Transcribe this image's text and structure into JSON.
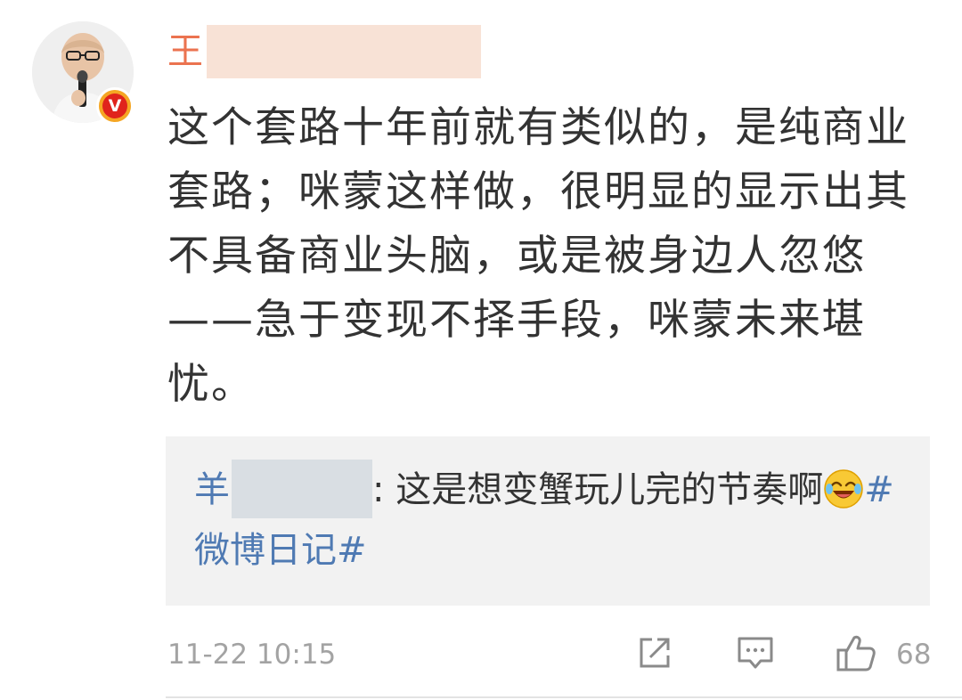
{
  "comment": {
    "author": {
      "name": "王",
      "verified_badge": "V"
    },
    "body": "这个套路十年前就有类似的，是纯商业套路；咪蒙这样做，很明显的显示出其不具备商业头脑，或是被身边人忽悠——急于变现不择手段，咪蒙未来堪忧。",
    "reply": {
      "user": "羊",
      "text_before_emoji": ": 这是想变蟹玩儿完的节奏啊",
      "emoji": "laughing-crying-emoji",
      "topic": "#微博日记#"
    },
    "footer": {
      "timestamp": "11-22 10:15",
      "like_count": "68",
      "icons": [
        "share-icon",
        "comment-icon",
        "like-icon"
      ]
    }
  },
  "colors": {
    "username": "#eb7350",
    "link": "#4f7ab3",
    "text": "#333333",
    "meta": "#a3a3a3",
    "reply_bg": "#f2f2f2"
  }
}
